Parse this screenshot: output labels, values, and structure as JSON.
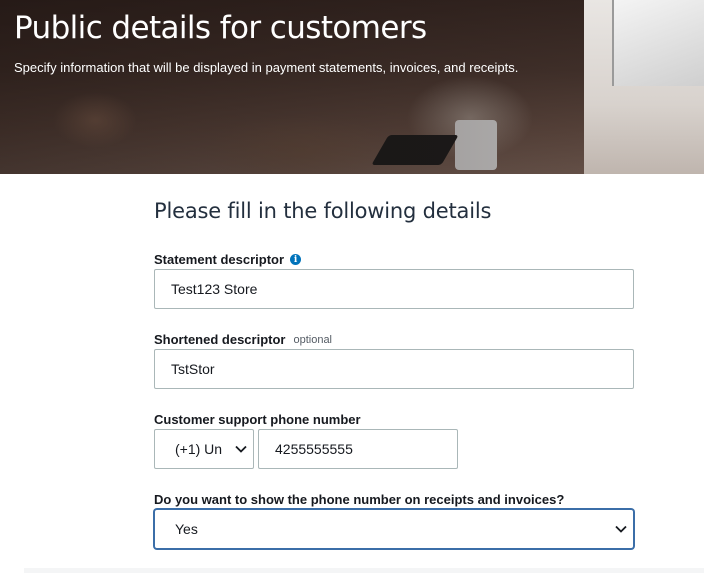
{
  "hero": {
    "title": "Public details for customers",
    "subtitle": "Specify information that will be displayed in payment statements, invoices, and receipts."
  },
  "form": {
    "heading": "Please fill in the following details",
    "statement_descriptor": {
      "label": "Statement descriptor",
      "info_icon": "info-icon",
      "value": "Test123 Store"
    },
    "shortened_descriptor": {
      "label": "Shortened descriptor",
      "optional_text": "optional",
      "value": "TstStor"
    },
    "phone": {
      "label": "Customer support phone number",
      "country_code": "(+1) Un",
      "number": "4255555555"
    },
    "show_phone": {
      "label": "Do you want to show the phone number on receipts and invoices?",
      "selected": "Yes"
    }
  },
  "colors": {
    "heading": "#232f3e",
    "info_icon": "#0073bb",
    "focus_border": "#3b6ea8",
    "input_border": "#aab7b8"
  }
}
